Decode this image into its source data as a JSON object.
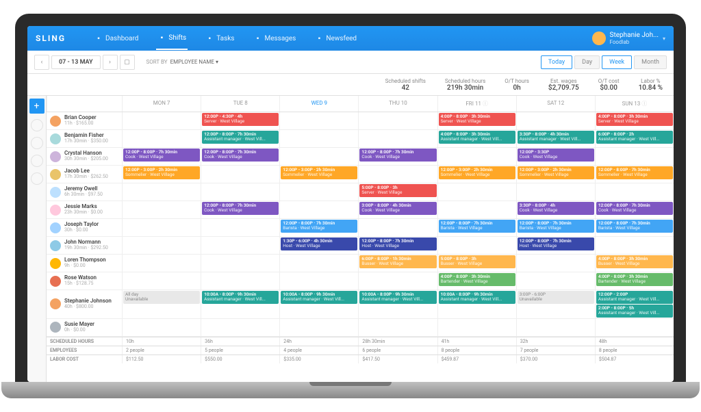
{
  "brand": "SLING",
  "nav": [
    {
      "label": "Dashboard",
      "icon": "dashboard-icon"
    },
    {
      "label": "Shifts",
      "icon": "grid-icon",
      "active": true
    },
    {
      "label": "Tasks",
      "icon": "check-icon"
    },
    {
      "label": "Messages",
      "icon": "message-icon"
    },
    {
      "label": "Newsfeed",
      "icon": "newsfeed-icon"
    }
  ],
  "user": {
    "name": "Stephanie Joh...",
    "org": "Foodlab"
  },
  "toolbar": {
    "date_range": "07 - 13 MAY",
    "sort_label": "SORT BY",
    "sort_value": "EMPLOYEE NAME",
    "today": "Today",
    "day": "Day",
    "week": "Week",
    "month": "Month"
  },
  "stats": [
    {
      "label": "Scheduled shifts",
      "value": "42"
    },
    {
      "label": "Scheduled hours",
      "value": "219h 30min"
    },
    {
      "label": "O/T hours",
      "value": "0h"
    },
    {
      "label": "Est. wages",
      "value": "$2,709.75"
    },
    {
      "label": "O/T cost",
      "value": "$0.00"
    },
    {
      "label": "Labor %",
      "value": "10.84 %"
    }
  ],
  "days": [
    "MON 7",
    "TUE 8",
    "WED 9",
    "THU 10",
    "FRI 11",
    "SAT 12",
    "SUN 13"
  ],
  "employees": [
    {
      "name": "Brian Cooper",
      "meta": "11h · $165.00",
      "av": "#f4a261",
      "shifts": [
        null,
        {
          "time": "12:00P - 4:30P · 4h",
          "role": "Server · West Village",
          "c": "c-red"
        },
        null,
        null,
        {
          "time": "4:00P - 8:00P · 3h 30min",
          "role": "Server · West Village",
          "c": "c-red"
        },
        null,
        {
          "time": "4:00P - 8:00P · 3h 30min",
          "role": "Server · West Village",
          "c": "c-red"
        }
      ]
    },
    {
      "name": "Benjamin Fisher",
      "meta": "17h 30min · $350.00",
      "av": "#a8dadc",
      "shifts": [
        null,
        {
          "time": "12:00P - 8:00P · 7h 30min",
          "role": "Assistant manager · West Vill...",
          "c": "c-teal"
        },
        null,
        null,
        {
          "time": "4:00P - 8:00P · 3h 30min",
          "role": "Assistant manager · West Vill...",
          "c": "c-teal"
        },
        {
          "time": "3:30P - 8:00P · 4h 30min",
          "role": "Assistant manager · West Vill...",
          "c": "c-teal"
        },
        {
          "time": "6:00P - 8:00P · 2h",
          "role": "Assistant manager · West Vill...",
          "c": "c-teal"
        }
      ]
    },
    {
      "name": "Crystal Hanson",
      "meta": "30h 30min · $205.00",
      "av": "#cdb4db",
      "shifts": [
        {
          "time": "12:00P - 8:00P · 7h 30min",
          "role": "Cook · West Village",
          "c": "c-purple"
        },
        {
          "time": "12:00P - 8:00P · 7h 30min",
          "role": "Cook · West Village",
          "c": "c-purple"
        },
        null,
        {
          "time": "12:00P - 8:00P · 7h 30min",
          "role": "Cook · West Village",
          "c": "c-purple"
        },
        null,
        {
          "time": "12:00P - 3:30P",
          "role": "Cook · West Village",
          "c": "c-purple"
        },
        null
      ]
    },
    {
      "name": "Jacob Lee",
      "meta": "17h 30min · $262.50",
      "av": "#e9c46a",
      "shifts": [
        {
          "time": "12:00P - 3:00P · 2h 30min",
          "role": "Sommelier · West Village",
          "c": "c-orange"
        },
        null,
        {
          "time": "12:00P - 3:00P · 2h 30min",
          "role": "Sommelier · West Village",
          "c": "c-orange"
        },
        null,
        {
          "time": "12:00P - 3:00P · 2h 30min",
          "role": "Sommelier · West Village",
          "c": "c-orange"
        },
        {
          "time": "12:00P - 3:00P · 2h 30min",
          "role": "Sommelier · West Village",
          "c": "c-orange"
        },
        {
          "time": "12:00P - 8:00P · 7h 30min",
          "role": "Sommelier · West Village",
          "c": "c-orange"
        }
      ]
    },
    {
      "name": "Jeremy Owell",
      "meta": "6h 30min · $97.50",
      "av": "#bde0fe",
      "shifts": [
        null,
        null,
        null,
        {
          "time": "5:00P - 8:00P · 3h",
          "role": "Server · West Village",
          "c": "c-red"
        },
        null,
        null,
        null
      ]
    },
    {
      "name": "Jessie Marks",
      "meta": "23h 30min · $0.00",
      "av": "#ffc8dd",
      "shifts": [
        null,
        {
          "time": "12:00P - 8:00P · 7h 30min",
          "role": "Cook · West Village",
          "c": "c-purple"
        },
        null,
        {
          "time": "3:00P - 8:00P · 4h 30min",
          "role": "Cook · West Village",
          "c": "c-purple"
        },
        null,
        {
          "time": "3:30P - 8:00P · 4h",
          "role": "Cook · West Village",
          "c": "c-purple"
        },
        {
          "time": "12:00P - 8:00P · 7h 30min",
          "role": "Cook · West Village",
          "c": "c-purple"
        }
      ]
    },
    {
      "name": "Joseph Taylor",
      "meta": "30h · $0.00",
      "av": "#a2d2ff",
      "shifts": [
        null,
        null,
        {
          "time": "12:00P - 8:00P · 7h 30min",
          "role": "Barista · West Village",
          "c": "c-blue"
        },
        null,
        {
          "time": "12:00P - 8:00P · 7h 30min",
          "role": "Barista · West Village",
          "c": "c-blue"
        },
        {
          "time": "12:00P - 8:00P · 7h 30min",
          "role": "Barista · West Village",
          "c": "c-blue"
        },
        {
          "time": "12:00P - 8:00P · 7h 30min",
          "role": "Barista · West Village",
          "c": "c-blue"
        }
      ]
    },
    {
      "name": "John Normann",
      "meta": "19h 30min · $292.50",
      "av": "#8ecae6",
      "shifts": [
        null,
        null,
        {
          "time": "1:30P - 6:00P · 4h 30min",
          "role": "Host · West Village",
          "c": "c-darkblue"
        },
        {
          "time": "12:00P - 8:00P · 7h 30min",
          "role": "Host · West Village",
          "c": "c-darkblue"
        },
        null,
        {
          "time": "12:00P - 8:00P · 7h 30min",
          "role": "Host · West Village",
          "c": "c-darkblue"
        },
        null
      ]
    },
    {
      "name": "Loren Thompson",
      "meta": "9h · $0.00",
      "av": "#ffb703",
      "shifts": [
        null,
        null,
        null,
        {
          "time": "6:00P - 8:00P · 1h 30min",
          "role": "Busser · West Village",
          "c": "c-amber"
        },
        {
          "time": "5:00P - 8:00P · 3h",
          "role": "Busser · West Village",
          "c": "c-amber"
        },
        null,
        {
          "time": "4:00P - 8:00P · 3h 30min",
          "role": "Busser · West Village",
          "c": "c-amber"
        }
      ]
    },
    {
      "name": "Rose Watson",
      "meta": "15h · $128.75",
      "av": "#e76f51",
      "shifts": [
        null,
        null,
        null,
        null,
        {
          "time": "4:00P - 8:00P · 3h 30min",
          "role": "Bartender · West Village",
          "c": "c-green"
        },
        null,
        {
          "time": "4:00P - 8:00P · 3h 30min",
          "role": "Bartender · West Village",
          "c": "c-green"
        }
      ]
    },
    {
      "name": "Stephanie Johnson",
      "meta": "40h · $800.00",
      "av": "#f4a261",
      "shifts": [
        {
          "unavail": true,
          "time": "All day",
          "role": "Unavailable"
        },
        {
          "time": "10:00A - 8:00P · 9h 30min",
          "role": "Assistant manager · West Vill...",
          "c": "c-teal"
        },
        {
          "time": "10:00A - 8:00P · 9h 30min",
          "role": "Assistant manager · West Vill...",
          "c": "c-teal"
        },
        {
          "time": "10:00A - 8:00P · 9h 30min",
          "role": "Assistant manager · West Vill...",
          "c": "c-teal"
        },
        {
          "time": "10:00A - 8:00P · 9h 30min",
          "role": "Assistant manager · West Vill...",
          "c": "c-teal"
        },
        {
          "unavail": true,
          "time": "3:00P - 6:00P",
          "role": "Unavailable"
        },
        {
          "time": "2:00P - 8:00P · 5h",
          "role": "Assistant manager · West Vill...",
          "c": "c-teal",
          "extra": {
            "time": "12:00P - 2:00P",
            "role": "Assistant manager · West Vill...",
            "c": "c-teal"
          }
        }
      ]
    },
    {
      "name": "Susie Mayer",
      "meta": "0h · $0.00",
      "av": "#adb5bd",
      "shifts": [
        null,
        null,
        null,
        null,
        null,
        null,
        null
      ]
    }
  ],
  "footer": {
    "labels": [
      "SCHEDULED HOURS",
      "EMPLOYEES",
      "LABOR COST"
    ],
    "cols": [
      {
        "hours": "10h",
        "emp": "2 people",
        "cost": "$112.50"
      },
      {
        "hours": "36h",
        "emp": "5 people",
        "cost": "$550.00"
      },
      {
        "hours": "24h",
        "emp": "4 people",
        "cost": "$335.00"
      },
      {
        "hours": "28h 30min",
        "emp": "6 people",
        "cost": "$417.50"
      },
      {
        "hours": "41h",
        "emp": "8 people",
        "cost": "$459.87"
      },
      {
        "hours": "32h",
        "emp": "7 people",
        "cost": "$370.00"
      },
      {
        "hours": "48h",
        "emp": "8 people",
        "cost": "$504.87"
      }
    ]
  }
}
